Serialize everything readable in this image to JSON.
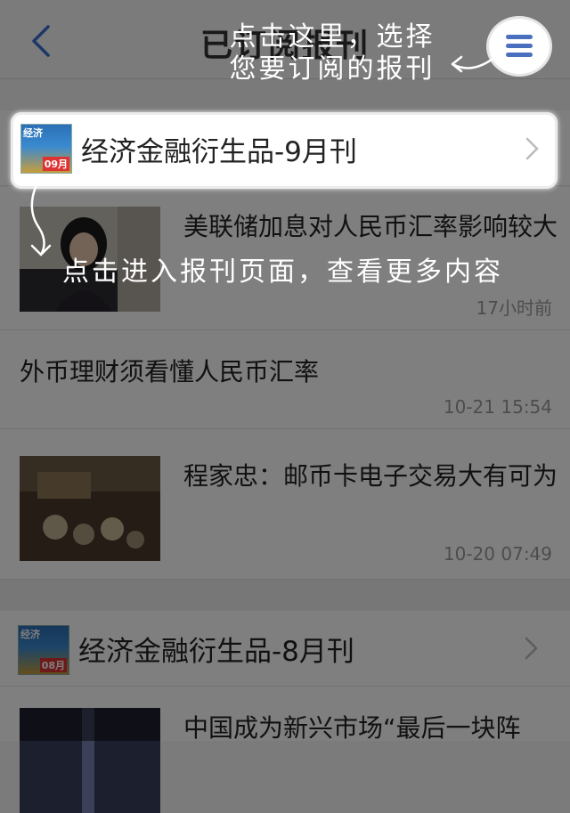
{
  "navbar": {
    "title": "已订阅报刊"
  },
  "sections": [
    {
      "title": "经济金融衍生品-9月刊",
      "cover": {
        "brand": "经济",
        "issue": "09月"
      },
      "articles": [
        {
          "title": "美联储加息对人民币汇率影响较大",
          "time": "17小时前",
          "has_thumb": true
        },
        {
          "title": "外币理财须看懂人民币汇率",
          "time": "10-21 15:54",
          "has_thumb": false
        },
        {
          "title": "程家忠：邮币卡电子交易大有可为",
          "time": "10-20 07:49",
          "has_thumb": true
        }
      ]
    },
    {
      "title": "经济金融衍生品-8月刊",
      "cover": {
        "brand": "经济",
        "issue": "08月"
      },
      "articles": [
        {
          "title": "中国成为新兴市场“最后一块阵",
          "has_thumb": true
        }
      ]
    }
  ],
  "overlay": {
    "hint_menu_line1": "点击这里，选择",
    "hint_menu_line2": "您要订阅的报刊",
    "hint_article": "点击进入报刊页面，查看更多内容"
  },
  "colors": {
    "accent": "#4a6fbf",
    "time": "#9a9a9a",
    "dim": "rgba(0,0,0,0.5)"
  },
  "icons": [
    "back-chevron-icon",
    "menu-icon",
    "chevron-right-icon",
    "curved-arrow-icon"
  ]
}
